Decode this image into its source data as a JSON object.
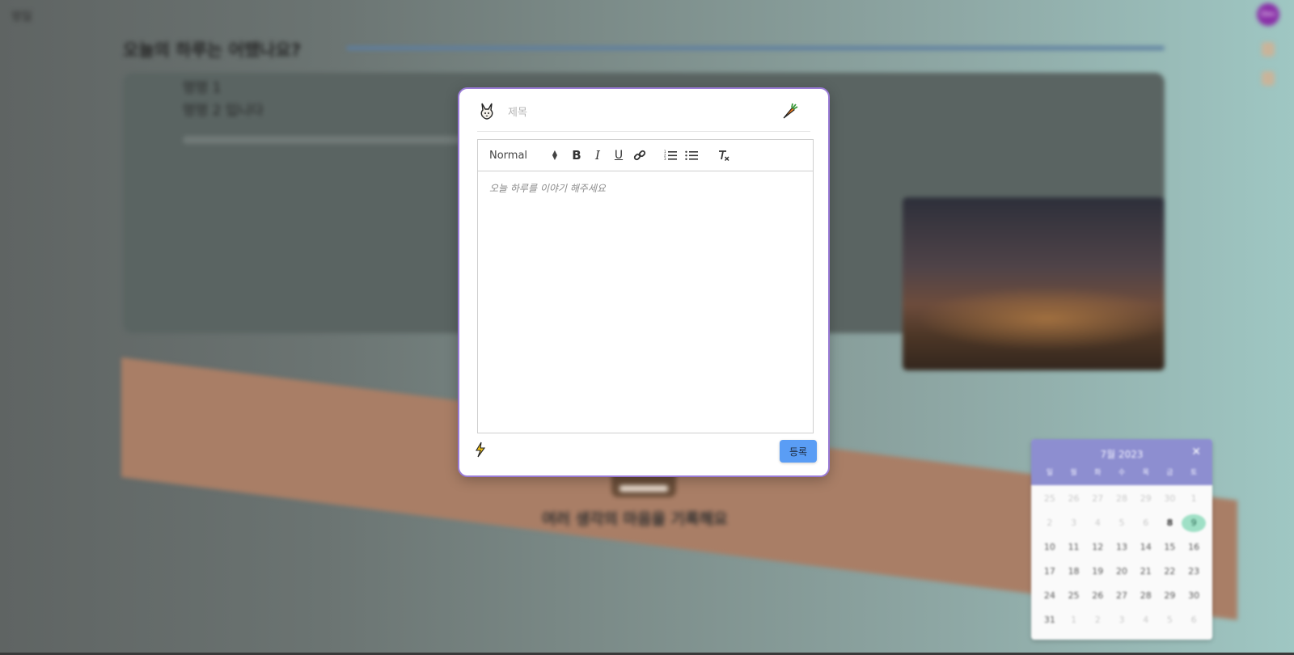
{
  "background": {
    "logo_text": "멍일",
    "avatar_text": "Dev",
    "page_title": "오늘의 하루는 어땠나요?",
    "card_line_1": "멍멍 1",
    "card_line_2": "멍멍 2 입니다",
    "caption": "여러 생각의 마음을 기록해요"
  },
  "modal": {
    "title_placeholder": "제목",
    "title_value": "",
    "editor_placeholder": "오늘 하루를 이야기 해주세요",
    "toolbar": {
      "format_select": "Normal",
      "bold": "B",
      "italic": "I",
      "underline": "U"
    },
    "submit_label": "등록",
    "icons": [
      "rabbit-icon",
      "carrot-icon",
      "lightning-icon",
      "link-icon",
      "ordered-list-icon",
      "bullet-list-icon",
      "clear-format-icon"
    ]
  },
  "calendar": {
    "month_label": "7월 2023",
    "close_symbol": "✕",
    "weekdays": [
      "일",
      "월",
      "화",
      "수",
      "목",
      "금",
      "토"
    ],
    "days": [
      {
        "d": "25",
        "muted": true
      },
      {
        "d": "26",
        "muted": true
      },
      {
        "d": "27",
        "muted": true
      },
      {
        "d": "28",
        "muted": true
      },
      {
        "d": "29",
        "muted": true
      },
      {
        "d": "30",
        "muted": true
      },
      {
        "d": "1",
        "muted": true
      },
      {
        "d": "2",
        "muted": true
      },
      {
        "d": "3",
        "muted": true
      },
      {
        "d": "4",
        "muted": true
      },
      {
        "d": "5",
        "muted": true
      },
      {
        "d": "6",
        "muted": true
      },
      {
        "d": "8",
        "today": true
      },
      {
        "d": "9",
        "selected": true
      },
      {
        "d": "10"
      },
      {
        "d": "11"
      },
      {
        "d": "12"
      },
      {
        "d": "13"
      },
      {
        "d": "14"
      },
      {
        "d": "15"
      },
      {
        "d": "16"
      },
      {
        "d": "17"
      },
      {
        "d": "18"
      },
      {
        "d": "19"
      },
      {
        "d": "20"
      },
      {
        "d": "21"
      },
      {
        "d": "22"
      },
      {
        "d": "23"
      },
      {
        "d": "24"
      },
      {
        "d": "25"
      },
      {
        "d": "26"
      },
      {
        "d": "27"
      },
      {
        "d": "28"
      },
      {
        "d": "29"
      },
      {
        "d": "30"
      },
      {
        "d": "31"
      },
      {
        "d": "1",
        "muted": true
      },
      {
        "d": "2",
        "muted": true
      },
      {
        "d": "3",
        "muted": true
      },
      {
        "d": "4",
        "muted": true
      },
      {
        "d": "5",
        "muted": true
      },
      {
        "d": "6",
        "muted": true
      }
    ]
  },
  "colors": {
    "modal_border": "#9a7bd6",
    "submit_button": "#5a9df5",
    "calendar_header": "#8d8ed0",
    "calendar_selected": "#9fe0c6"
  }
}
